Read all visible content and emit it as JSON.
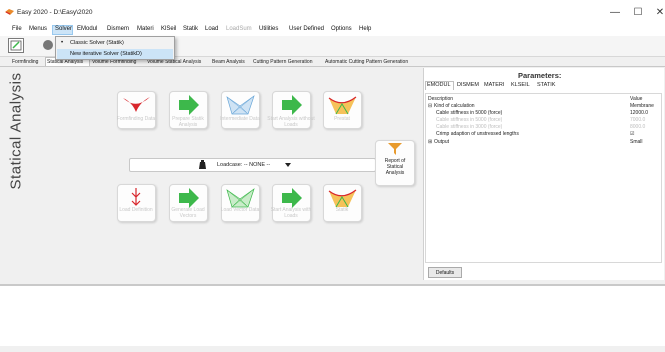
{
  "window": {
    "title": "Easy 2020 - D:\\Easy\\2020",
    "controls": {
      "minimize": "—",
      "maximize": "☐",
      "close": "✕"
    }
  },
  "menu": [
    "File",
    "Menus",
    "Solver",
    "EModul",
    "Dismem",
    "Materi",
    "KlSeil",
    "Statik",
    "Load",
    "LoadSum",
    "Utilities",
    "User Defined",
    "Options",
    "Help"
  ],
  "solver_menu": {
    "items": [
      {
        "label": "Classic Solver (Statik)",
        "checked": true
      },
      {
        "label": "New iterative Solver (StatikD)",
        "checked": false
      }
    ],
    "check_glyph": "•"
  },
  "tabs": [
    "Formfinding",
    "Statical Analysis",
    "Volume Formfinding",
    "Volume Statical Analysis",
    "Beam Analysis",
    "Cutting Pattern Generation",
    "Automatic Cutting Pattern Generation"
  ],
  "side_title": "Statical Analysis",
  "workflow": {
    "top": [
      "Formfinding Data",
      "Prepare Statik Analysis",
      "Intermediate Data",
      "Start Analysis without Loads",
      "Prestat"
    ],
    "bottom": [
      "Load Definition",
      "Generate Load Vectors",
      "Load Vector Data",
      "Start Analysis with Loads",
      "Statik"
    ],
    "loadcase": "Loadcase: -- NONE --",
    "report": [
      "Report of",
      "Statical",
      "Analysis"
    ]
  },
  "parameters": {
    "title": "Parameters:",
    "tabs": [
      "EMODUL",
      "DISMEM",
      "MATERI",
      "KLSEIL",
      "STATIK"
    ],
    "columns": [
      "Description",
      "Value"
    ],
    "rows": [
      {
        "expander": "⊟",
        "label": "Kind of calculation",
        "value": "Membrane",
        "indent": false,
        "disabled": false
      },
      {
        "expander": "",
        "label": "Cable stiffness in 5000 (force)",
        "value": "12000.0",
        "indent": true,
        "disabled": false
      },
      {
        "expander": "",
        "label": "Cable stiffness in 5000 (force)",
        "value": "7000.0",
        "indent": true,
        "disabled": true
      },
      {
        "expander": "",
        "label": "Cable stiffness in 3000 (force)",
        "value": "8000.0",
        "indent": true,
        "disabled": true
      },
      {
        "expander": "",
        "label": "Crimp adaption of unstressed lengths",
        "value": "☑",
        "indent": true,
        "disabled": false
      },
      {
        "expander": "⊞",
        "label": "Output",
        "value": "Small",
        "indent": false,
        "disabled": false
      }
    ],
    "defaults_label": "Defaults"
  },
  "colors": {
    "green": "#3db84b",
    "red": "#d8262c",
    "blue_mesh": "#6aa7d8",
    "selection": "#cce4f7"
  }
}
